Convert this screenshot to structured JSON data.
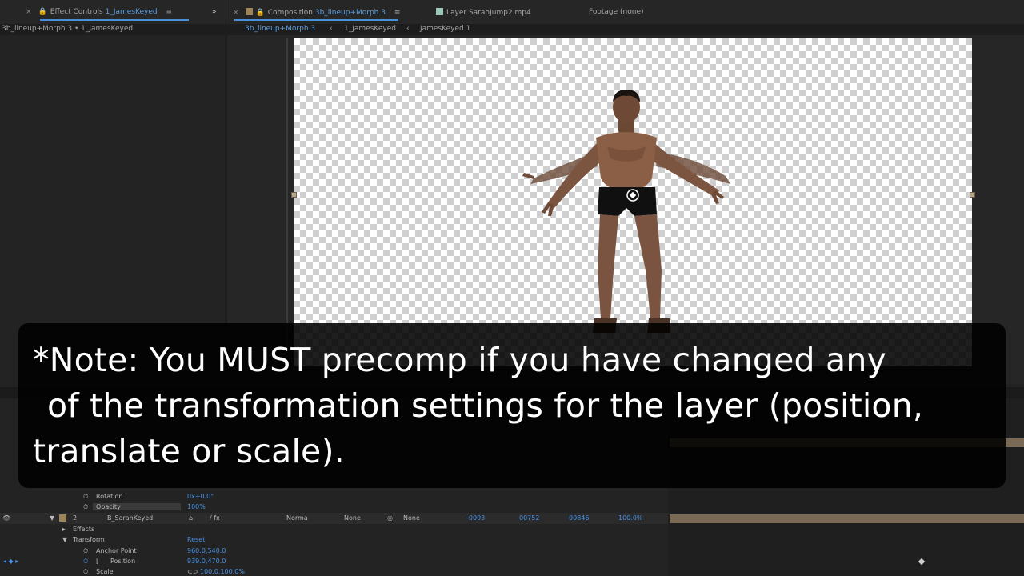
{
  "left_panel": {
    "close": "×",
    "tab_prefix": "Effect Controls",
    "tab_layer": "1_JamesKeyed",
    "menu": "≡",
    "expand": "»",
    "breadcrumb": "3b_lineup+Morph 3 • 1_JamesKeyed"
  },
  "comp_panel": {
    "close": "×",
    "tab_prefix": "Composition",
    "tab_comp": "3b_lineup+Morph 3",
    "menu": "≡",
    "layer_tab": "Layer SarahJump2.mp4",
    "footage_tab": "Footage (none)",
    "crumbs": [
      "3b_lineup+Morph 3",
      "1_JamesKeyed",
      "JamesKeyed 1"
    ],
    "crumb_sep": "‹"
  },
  "timeline": {
    "rows": [
      {
        "name": "Rotation",
        "value": "0x+0.0°"
      },
      {
        "name": "Opacity",
        "value": "100%"
      }
    ],
    "layer2": {
      "index": "2",
      "name": "B_SarahKeyed",
      "mode": "Norma",
      "trkmat": "None",
      "parent": "None",
      "in": "-0093",
      "out": "00752",
      "duration": "00846",
      "stretch": "100.0%"
    },
    "effects": "Effects",
    "transform": "Transform",
    "reset": "Reset",
    "anchor_point": {
      "name": "Anchor Point",
      "value": "960.0,540.0"
    },
    "position": {
      "name": "Position",
      "value": "939.0,470.0"
    },
    "scale": {
      "name": "Scale",
      "value": "100.0,100.0%"
    }
  },
  "caption": {
    "line1": "*Note: You MUST precomp if you have changed any",
    "line2": "of the transformation settings for the layer (position,",
    "line3": "translate or scale)."
  },
  "colors": {
    "accent": "#4a90d9",
    "panel": "#232323",
    "background": "#1d1d1d"
  }
}
